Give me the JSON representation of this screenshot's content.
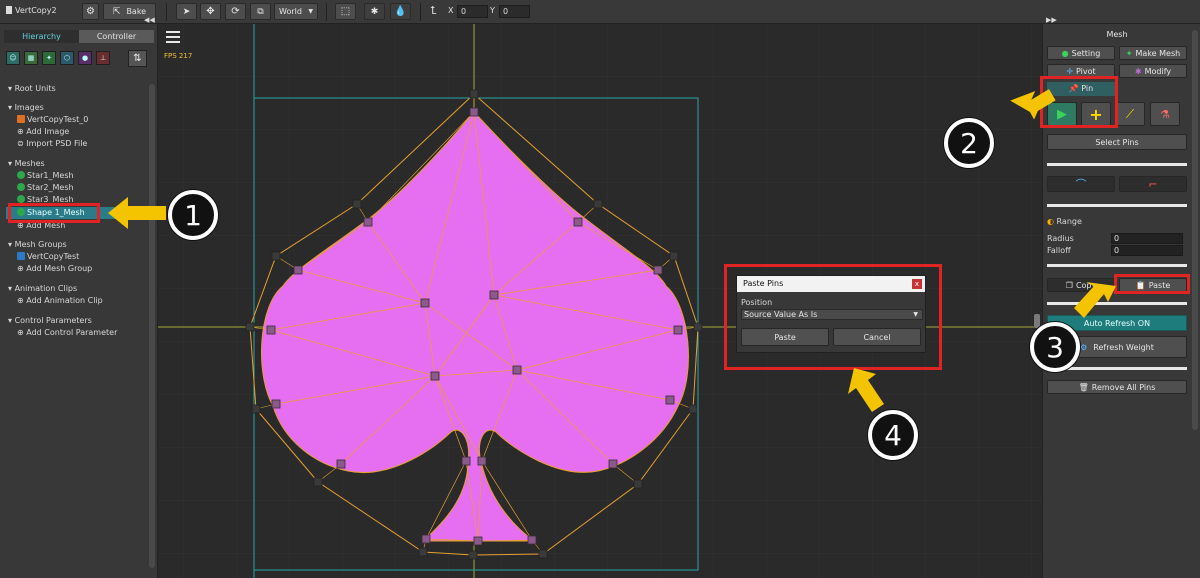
{
  "toolbar": {
    "project_name": "VertCopy2",
    "bake_label": "Bake",
    "space_select": "World",
    "x_label": "X",
    "x_value": "0",
    "y_label": "Y",
    "y_value": "0"
  },
  "left_panel": {
    "tabs": [
      "Hierarchy",
      "Controller"
    ],
    "sections": {
      "root_units": "Root Units",
      "images": "Images",
      "image_items": [
        "VertCopyTest_0",
        "Add Image",
        "Import PSD File"
      ],
      "meshes": "Meshes",
      "mesh_items": [
        "Star1_Mesh",
        "Star2_Mesh",
        "Star3_Mesh",
        "Shape 1_Mesh",
        "Add Mesh"
      ],
      "mesh_groups": "Mesh Groups",
      "mesh_group_items": [
        "VertCopyTest",
        "Add Mesh Group"
      ],
      "animation_clips": "Animation Clips",
      "animation_items": [
        "Add Animation Clip"
      ],
      "control_parameters": "Control Parameters",
      "control_items": [
        "Add Control Parameter"
      ]
    }
  },
  "canvas": {
    "fps": "FPS 217"
  },
  "right_panel": {
    "title": "Mesh",
    "buttons": {
      "setting": "Setting",
      "make_mesh": "Make Mesh",
      "pivot": "Pivot",
      "modify": "Modify",
      "pin": "Pin",
      "select_pins": "Select Pins",
      "copy": "Copy",
      "paste": "Paste",
      "auto_refresh": "Auto Refresh ON",
      "refresh_weight": "Refresh Weight",
      "remove_all_pins": "Remove All Pins"
    },
    "range_label": "Range",
    "radius_label": "Radius",
    "radius_value": "0",
    "falloff_label": "Falloff",
    "falloff_value": "0"
  },
  "dialog": {
    "title": "Paste Pins",
    "close": "x",
    "position_label": "Position",
    "position_value": "Source Value As Is",
    "paste": "Paste",
    "cancel": "Cancel"
  },
  "annotations": [
    "1",
    "2",
    "3",
    "4"
  ],
  "colors": {
    "accent_teal": "#2a7c8a",
    "highlight_red": "#e02424",
    "arrow_yellow": "#f5c400",
    "mesh_fill": "#e66ef0"
  }
}
